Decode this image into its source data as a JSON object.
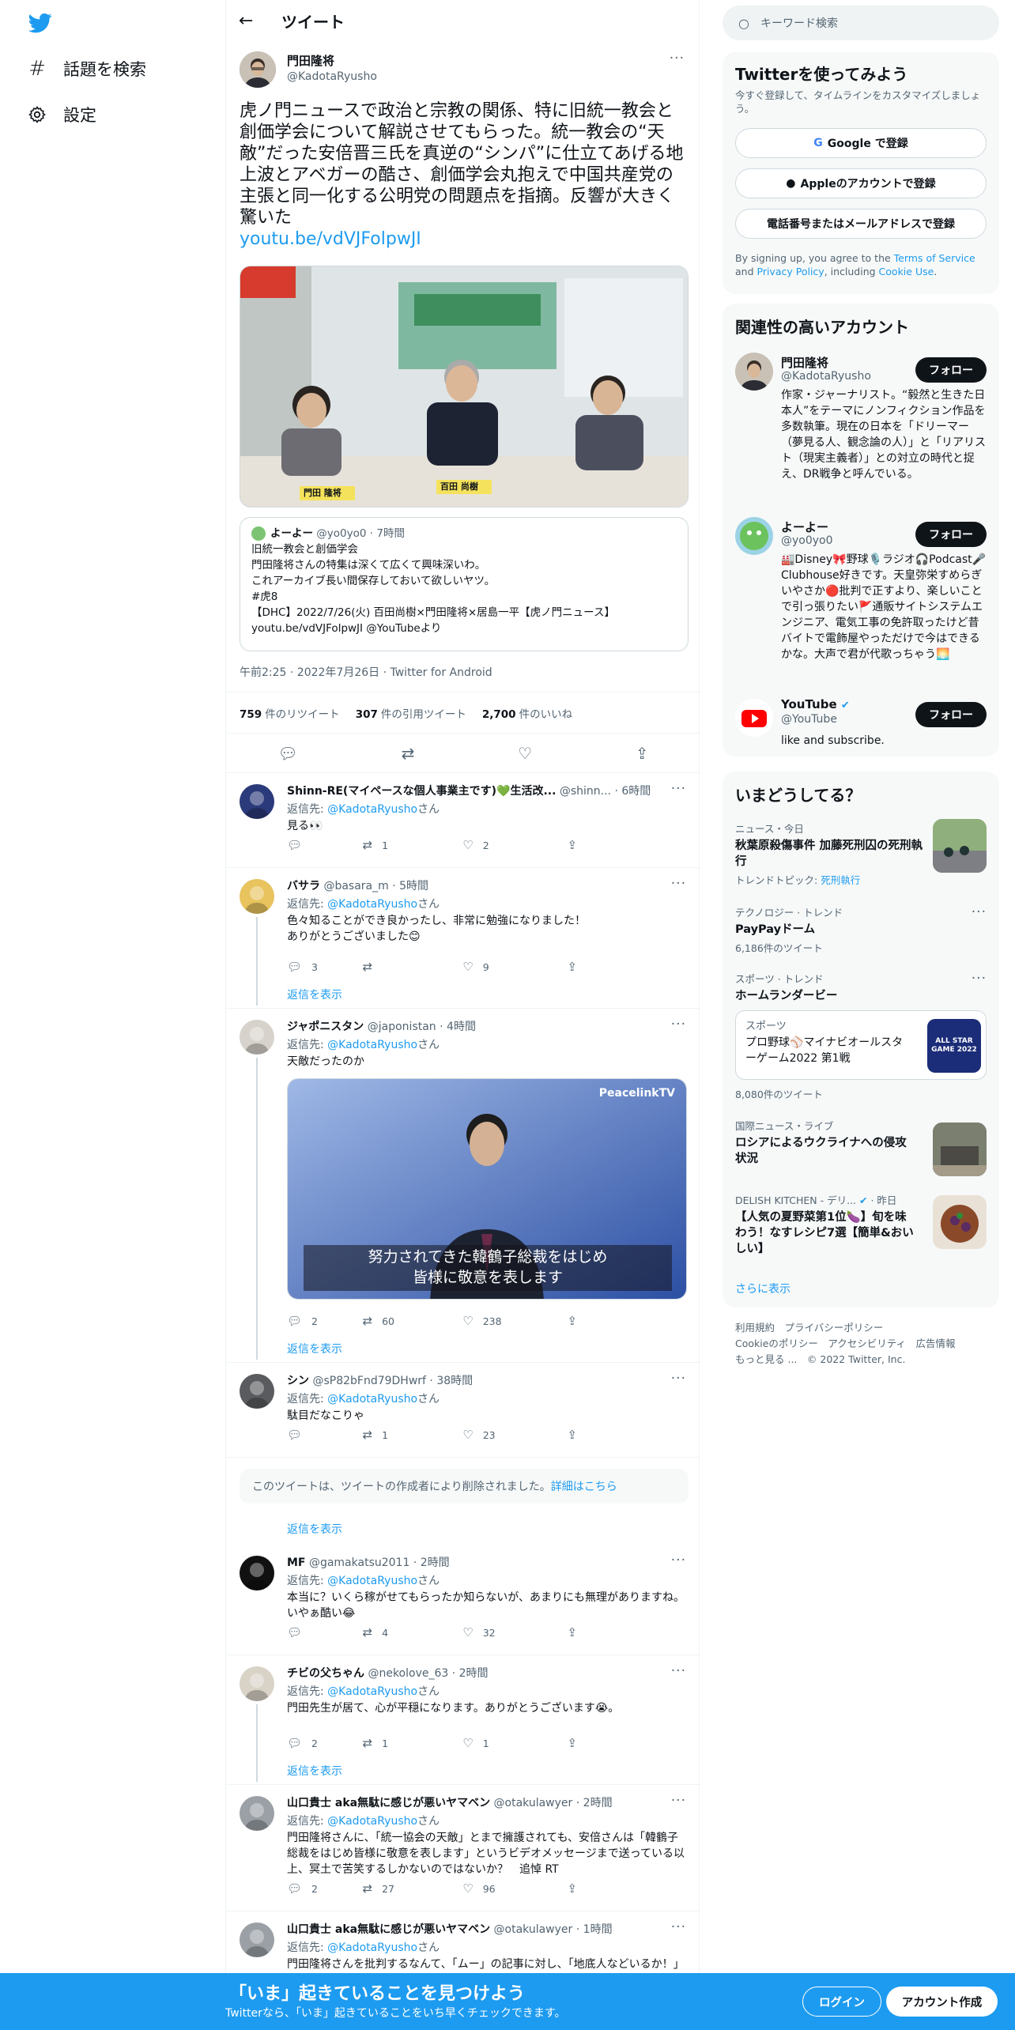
{
  "nav": {
    "explore_label": "話題を検索",
    "settings_label": "設定"
  },
  "header": {
    "title": "ツイート"
  },
  "tweet": {
    "name": "門田隆将",
    "handle": "@KadotaRyusho",
    "text": "虎ノ門ニュースで政治と宗教の関係、特に旧統一教会と創価学会について解説させてもらった。統一教会の“天敵”だった安倍晋三氏を真逆の“シンパ”に仕立てあげる地上波とアベガーの酷さ、創価学会丸抱えで中国共産党の主張と同一化する公明党の問題点を指摘。反響が大きく驚いた",
    "link": "youtu.be/vdVJFolpwJI",
    "quote": {
      "name": "よーよー",
      "handle": "@yo0yo0",
      "time": "7時間",
      "lines": [
        "旧統一教会と創価学会",
        "門田隆将さんの特集は深くて広くて興味深いわ。",
        "これアーカイブ長い間保存しておいて欲しいヤツ。",
        "#虎8",
        "【DHC】2022/7/26(火) 百田尚樹×門田隆将×居島一平【虎ノ門ニュース】",
        "youtu.be/vdVJFolpwJI @YouTubeより"
      ]
    },
    "meta": "午前2:25 · 2022年7月26日 · Twitter for Android",
    "retweets": "759",
    "retweets_label": "件のリツイート",
    "quotes": "307",
    "quotes_label": "件の引用ツイート",
    "likes": "2,700",
    "likes_label": "件のいいね",
    "image_caption": "百田 尚樹",
    "image_caption2": "門田 隆将"
  },
  "replying_to": "返信先: ",
  "replying_handle": "@KadotaRyusho",
  "replying_suffix": "さん",
  "show_replies": "返信を表示",
  "replies": [
    {
      "name": "Shinn-RE(マイペースな個人事業主です)💚生活改...",
      "handle": "@shinn...",
      "time": "6時間",
      "text": "見る👀",
      "replies": "",
      "retweets": "1",
      "likes": "2"
    },
    {
      "name": "バサラ",
      "handle": "@basara_m",
      "time": "5時間",
      "text": "色々知ることができ良かったし、非常に勉強になりました！\nありがとうございました😊",
      "replies": "3",
      "retweets": "",
      "likes": "9"
    },
    {
      "name": "ジャポニスタン",
      "handle": "@japonistan",
      "time": "4時間",
      "text": "天敵だったのか",
      "replies": "2",
      "retweets": "60",
      "likes": "238",
      "video_sub1": "努力されてきた韓鶴子総裁をはじめ",
      "video_sub2": "皆様に敬意を表します",
      "video_brand": "PeacelinkTV"
    },
    {
      "name": "シン",
      "handle": "@sP82bFnd79DHwrf",
      "time": "38時間",
      "text": "駄目だなこりゃ",
      "replies": "",
      "retweets": "1",
      "likes": "23"
    },
    {
      "name": "MF",
      "handle": "@gamakatsu2011",
      "time": "2時間",
      "text": "本当に？いくら稼がせてもらったか知らないが、あまりにも無理がありますね。いやぁ酷い😂",
      "replies": "",
      "retweets": "4",
      "likes": "32"
    },
    {
      "name": "チビの父ちゃん",
      "handle": "@nekolove_63",
      "time": "2時間",
      "text": "門田先生が居て、心が平穏になります。ありがとうございます😭。",
      "replies": "2",
      "retweets": "1",
      "likes": "1"
    },
    {
      "name": "山口貴士 aka無駄に感じが悪いヤマベン",
      "handle": "@otakulawyer",
      "time": "2時間",
      "text": "門田隆将さんに、「統一協会の天敵」とまで擁護されても、安倍さんは「韓鶴子総裁をはじめ皆様に敬意を表します」というビデオメッセージまで送っている以上、冥土で苦笑するしかないのではないか？　追悼 RT",
      "replies": "2",
      "retweets": "27",
      "likes": "96"
    },
    {
      "name": "山口貴士 aka無駄に感じが悪いヤマベン",
      "handle": "@otakulawyer",
      "time": "1時間",
      "text": "門田隆将さんを批判するなんて、「ムー」の記事に対し、「地底人などいるか！」と批判するような野暮な仕事でした。ごめんなさい。RT"
    }
  ],
  "deleted": {
    "text": "このツイートは、ツイートの作成者により削除されました。",
    "link": "詳細はこちら"
  },
  "search": {
    "placeholder": "キーワード検索"
  },
  "signup_card": {
    "title": "Twitterを使ってみよう",
    "subtitle": "今すぐ登録して、タイムラインをカスタマイズしましょう。",
    "google": "Google で登録",
    "apple": "Appleのアカウントで登録",
    "email": "電話番号またはメールアドレスで登録",
    "terms_pre": "By signing up, you agree to the ",
    "terms": "Terms of Service",
    "terms_and": " and ",
    "privacy": "Privacy Policy",
    "terms_inc": ", including ",
    "cookie": "Cookie Use",
    "terms_end": "."
  },
  "relevant": {
    "title": "関連性の高いアカウント",
    "follow": "フォロー",
    "accounts": [
      {
        "name": "門田隆将",
        "handle": "@KadotaRyusho",
        "bio": "作家・ジャーナリスト。“毅然と生きた日本人”をテーマにノンフィクション作品を多数執筆。現在の日本を「ドリーマー（夢見る人、観念論の人）」と「リアリスト（現実主義者）」との対立の時代と捉え、DR戦争と呼んでいる。"
      },
      {
        "name": "よーよー",
        "handle": "@yo0yo0",
        "bio": "🏭Disney🎀野球🎙️ラジオ🎧Podcast🎤Clubhouse好きです。天皇弥栄すめらぎいやさか🔴批判で正すより、楽しいことで引っ張りたい🚩通販サイトシステムエンジニア、電気工事の免許取ったけど昔バイトで電飾屋やっただけで今はできるかな。大声で君が代歌っちゃう🌅"
      },
      {
        "name": "YouTube",
        "handle": "@YouTube",
        "bio": "like and subscribe."
      }
    ]
  },
  "trends": {
    "title": "いまどうしてる？",
    "items": [
      {
        "cat": "ニュース・今日",
        "title": "秋葉原殺傷事件 加藤死刑囚の死刑執行",
        "sub_pre": "トレンドトピック: ",
        "sub_link": "死刑執行"
      },
      {
        "cat": "テクノロジー · トレンド",
        "title": "PayPayドーム",
        "sub": "6,186件のツイート"
      },
      {
        "cat": "スポーツ · トレンド",
        "title": "ホームランダービー",
        "inner_cat": "スポーツ",
        "inner_title": "プロ野球⚾マイナビオールスターゲーム2022 第1戦",
        "sub": "8,080件のツイート",
        "badge": "ALL STAR GAME 2022"
      },
      {
        "cat": "国際ニュース・ライブ",
        "title": "ロシアによるウクライナへの侵攻状況"
      },
      {
        "cat": "DELISH KITCHEN - デリ...",
        "cat_time": "· 昨日",
        "title": "【人気の夏野菜第1位🍆】旬を味わう！なすレシピ7選【簡単&おいしい】"
      }
    ],
    "more": "さらに表示"
  },
  "footer": {
    "line1": "利用規約　プライバシーポリシー",
    "line2": "Cookieのポリシー　アクセシビリティ　広告情報",
    "line3": "もっと見る ...　© 2022 Twitter, Inc."
  },
  "bottom": {
    "title": "「いま」起きていることを見つけよう",
    "subtitle": "Twitterなら、「いま」起きていることをいち早くチェックできます。",
    "login": "ログイン",
    "signup": "アカウント作成"
  },
  "colors": {
    "accent": "#1d9bf0",
    "text": "#0f1419",
    "muted": "#536471"
  }
}
